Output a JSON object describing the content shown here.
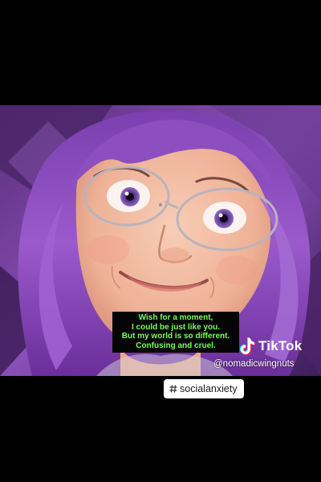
{
  "caption": {
    "lines": [
      "Wish for a moment,",
      "I could be just like you.",
      "But my world is so different.",
      "Confusing and cruel."
    ],
    "color": "#7CFC5C"
  },
  "watermark": {
    "brand": "TikTok",
    "icon": "tiktok-note-icon",
    "username": "@nomadicwingnuts"
  },
  "hashtag": {
    "icon": "hashtag-icon",
    "text": "socialanxiety"
  },
  "colors": {
    "background": "#000000",
    "hair": "#8a4fb8",
    "skin": "#f3c1a8"
  }
}
